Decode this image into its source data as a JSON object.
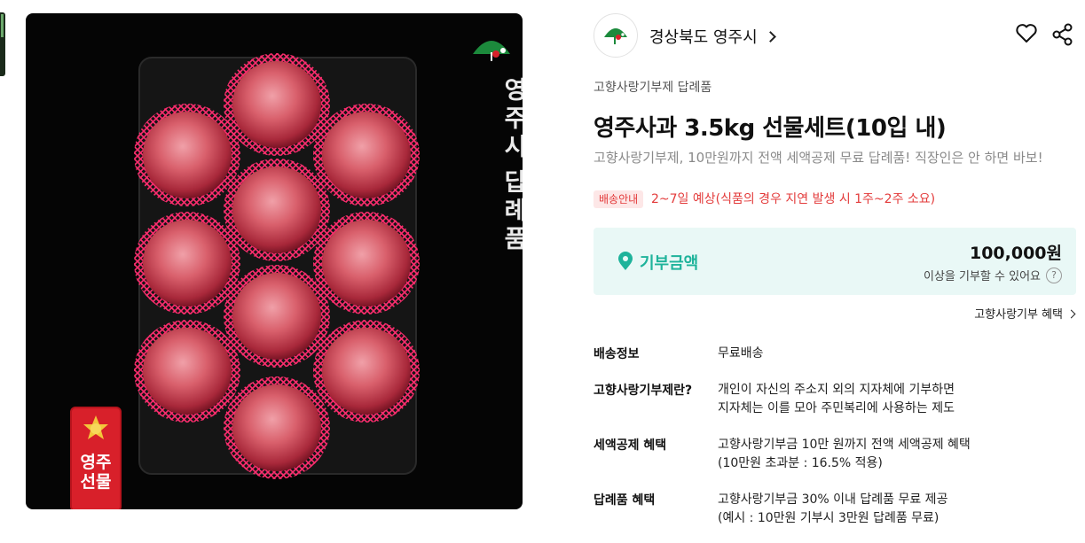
{
  "image_overlay": {
    "vertical_title": [
      "영",
      "주",
      "시",
      "답",
      "례",
      "품"
    ],
    "gift_label": [
      "영주",
      "선물"
    ]
  },
  "region": {
    "name": "경상북도 영주시"
  },
  "product": {
    "category": "고향사랑기부제 답례품",
    "title": "영주사과 3.5kg 선물세트(10입 내)",
    "subtitle": "고향사랑기부제, 10만원까지 전액 세액공제 무료 답례품! 직장인은 안 하면 바보!"
  },
  "shipping": {
    "badge": "배송안내",
    "text": "2~7일 예상(식품의 경우 지연 발생 시 1주~2주 소요)"
  },
  "donation": {
    "label": "기부금액",
    "amount": "100,000원",
    "note": "이상을 기부할 수 있어요",
    "help": "?"
  },
  "benefit_link": "고향사랑기부 혜택",
  "info_rows": [
    {
      "key": "배송정보",
      "lines": [
        "무료배송"
      ]
    },
    {
      "key": "고향사랑기부제란?",
      "lines": [
        "개인이 자신의 주소지 외의 지자체에 기부하면",
        "지자체는 이를 모아 주민복리에 사용하는 제도"
      ]
    },
    {
      "key": "세액공제 혜택",
      "lines": [
        "고향사랑기부금 10만 원까지 전액 세액공제 혜택",
        "(10만원 초과분 : 16.5% 적용)"
      ]
    },
    {
      "key": "답례품 혜택",
      "lines": [
        "고향사랑기부금 30% 이내 답례품 무료 제공",
        "(예시 : 10만원 기부시 3만원 답례품 무료)"
      ]
    }
  ],
  "colors": {
    "accent": "#1fb39b",
    "alert": "#e33b3b",
    "donation_bg": "#e9f8f6"
  }
}
